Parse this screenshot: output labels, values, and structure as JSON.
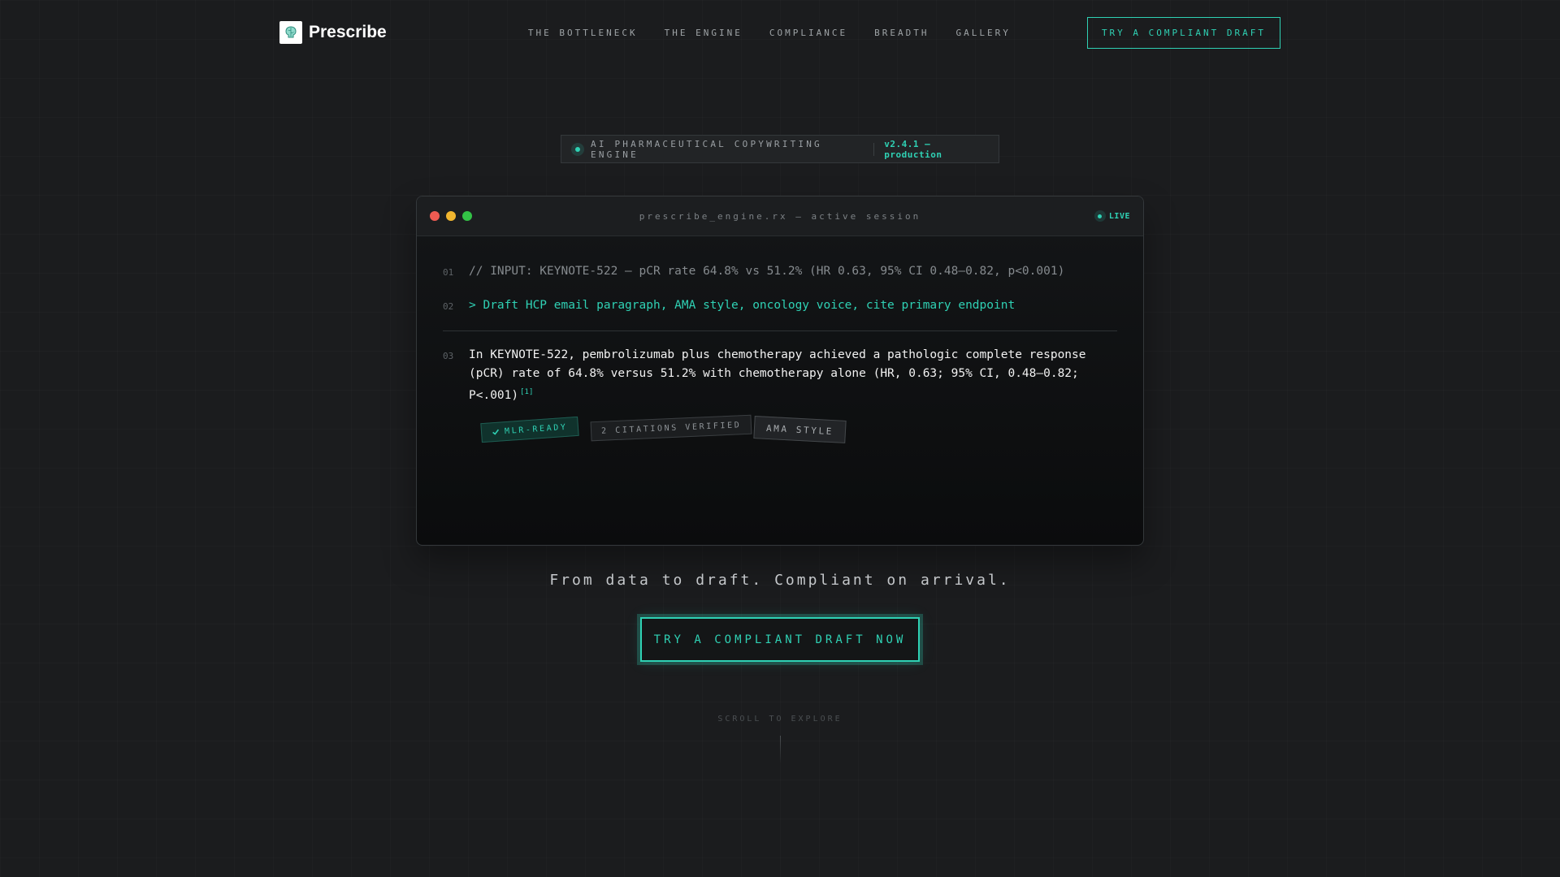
{
  "nav": {
    "brand": "Prescribe",
    "links": [
      "THE BOTTLENECK",
      "THE ENGINE",
      "COMPLIANCE",
      "BREADTH",
      "GALLERY"
    ],
    "cta": "TRY A COMPLIANT DRAFT"
  },
  "badge": {
    "label": "AI PHARMACEUTICAL COPYWRITING ENGINE",
    "version": "v2.4.1 — production"
  },
  "terminal": {
    "title": "prescribe_engine.rx — active session",
    "status": "LIVE",
    "lines": [
      {
        "num": "01",
        "text": "// INPUT: KEYNOTE-522 — pCR rate 64.8% vs 51.2% (HR 0.63, 95% CI 0.48–0.82, p<0.001)"
      },
      {
        "num": "02",
        "text": "> Draft HCP email paragraph, AMA style, oncology voice, cite primary endpoint"
      },
      {
        "num": "03",
        "text": "In KEYNOTE-522, pembrolizumab plus chemotherapy achieved a pathologic complete response (pCR) rate of 64.8% versus 51.2% with chemotherapy alone (HR, 0.63; 95% CI, 0.48–0.82; P<.001)",
        "citation": "[1]"
      }
    ],
    "tags": [
      "MLR-READY",
      "2 CITATIONS VERIFIED",
      "AMA STYLE"
    ]
  },
  "hero": {
    "tagline": "From data to draft. Compliant on arrival.",
    "cta": "TRY A COMPLIANT DRAFT NOW",
    "scroll_hint": "SCROLL TO EXPLORE"
  },
  "colors": {
    "accent": "#2fd1b4",
    "background": "#1b1c1e",
    "dot_red": "#ef5b52",
    "dot_yellow": "#f1b62f",
    "dot_green": "#33c246"
  }
}
